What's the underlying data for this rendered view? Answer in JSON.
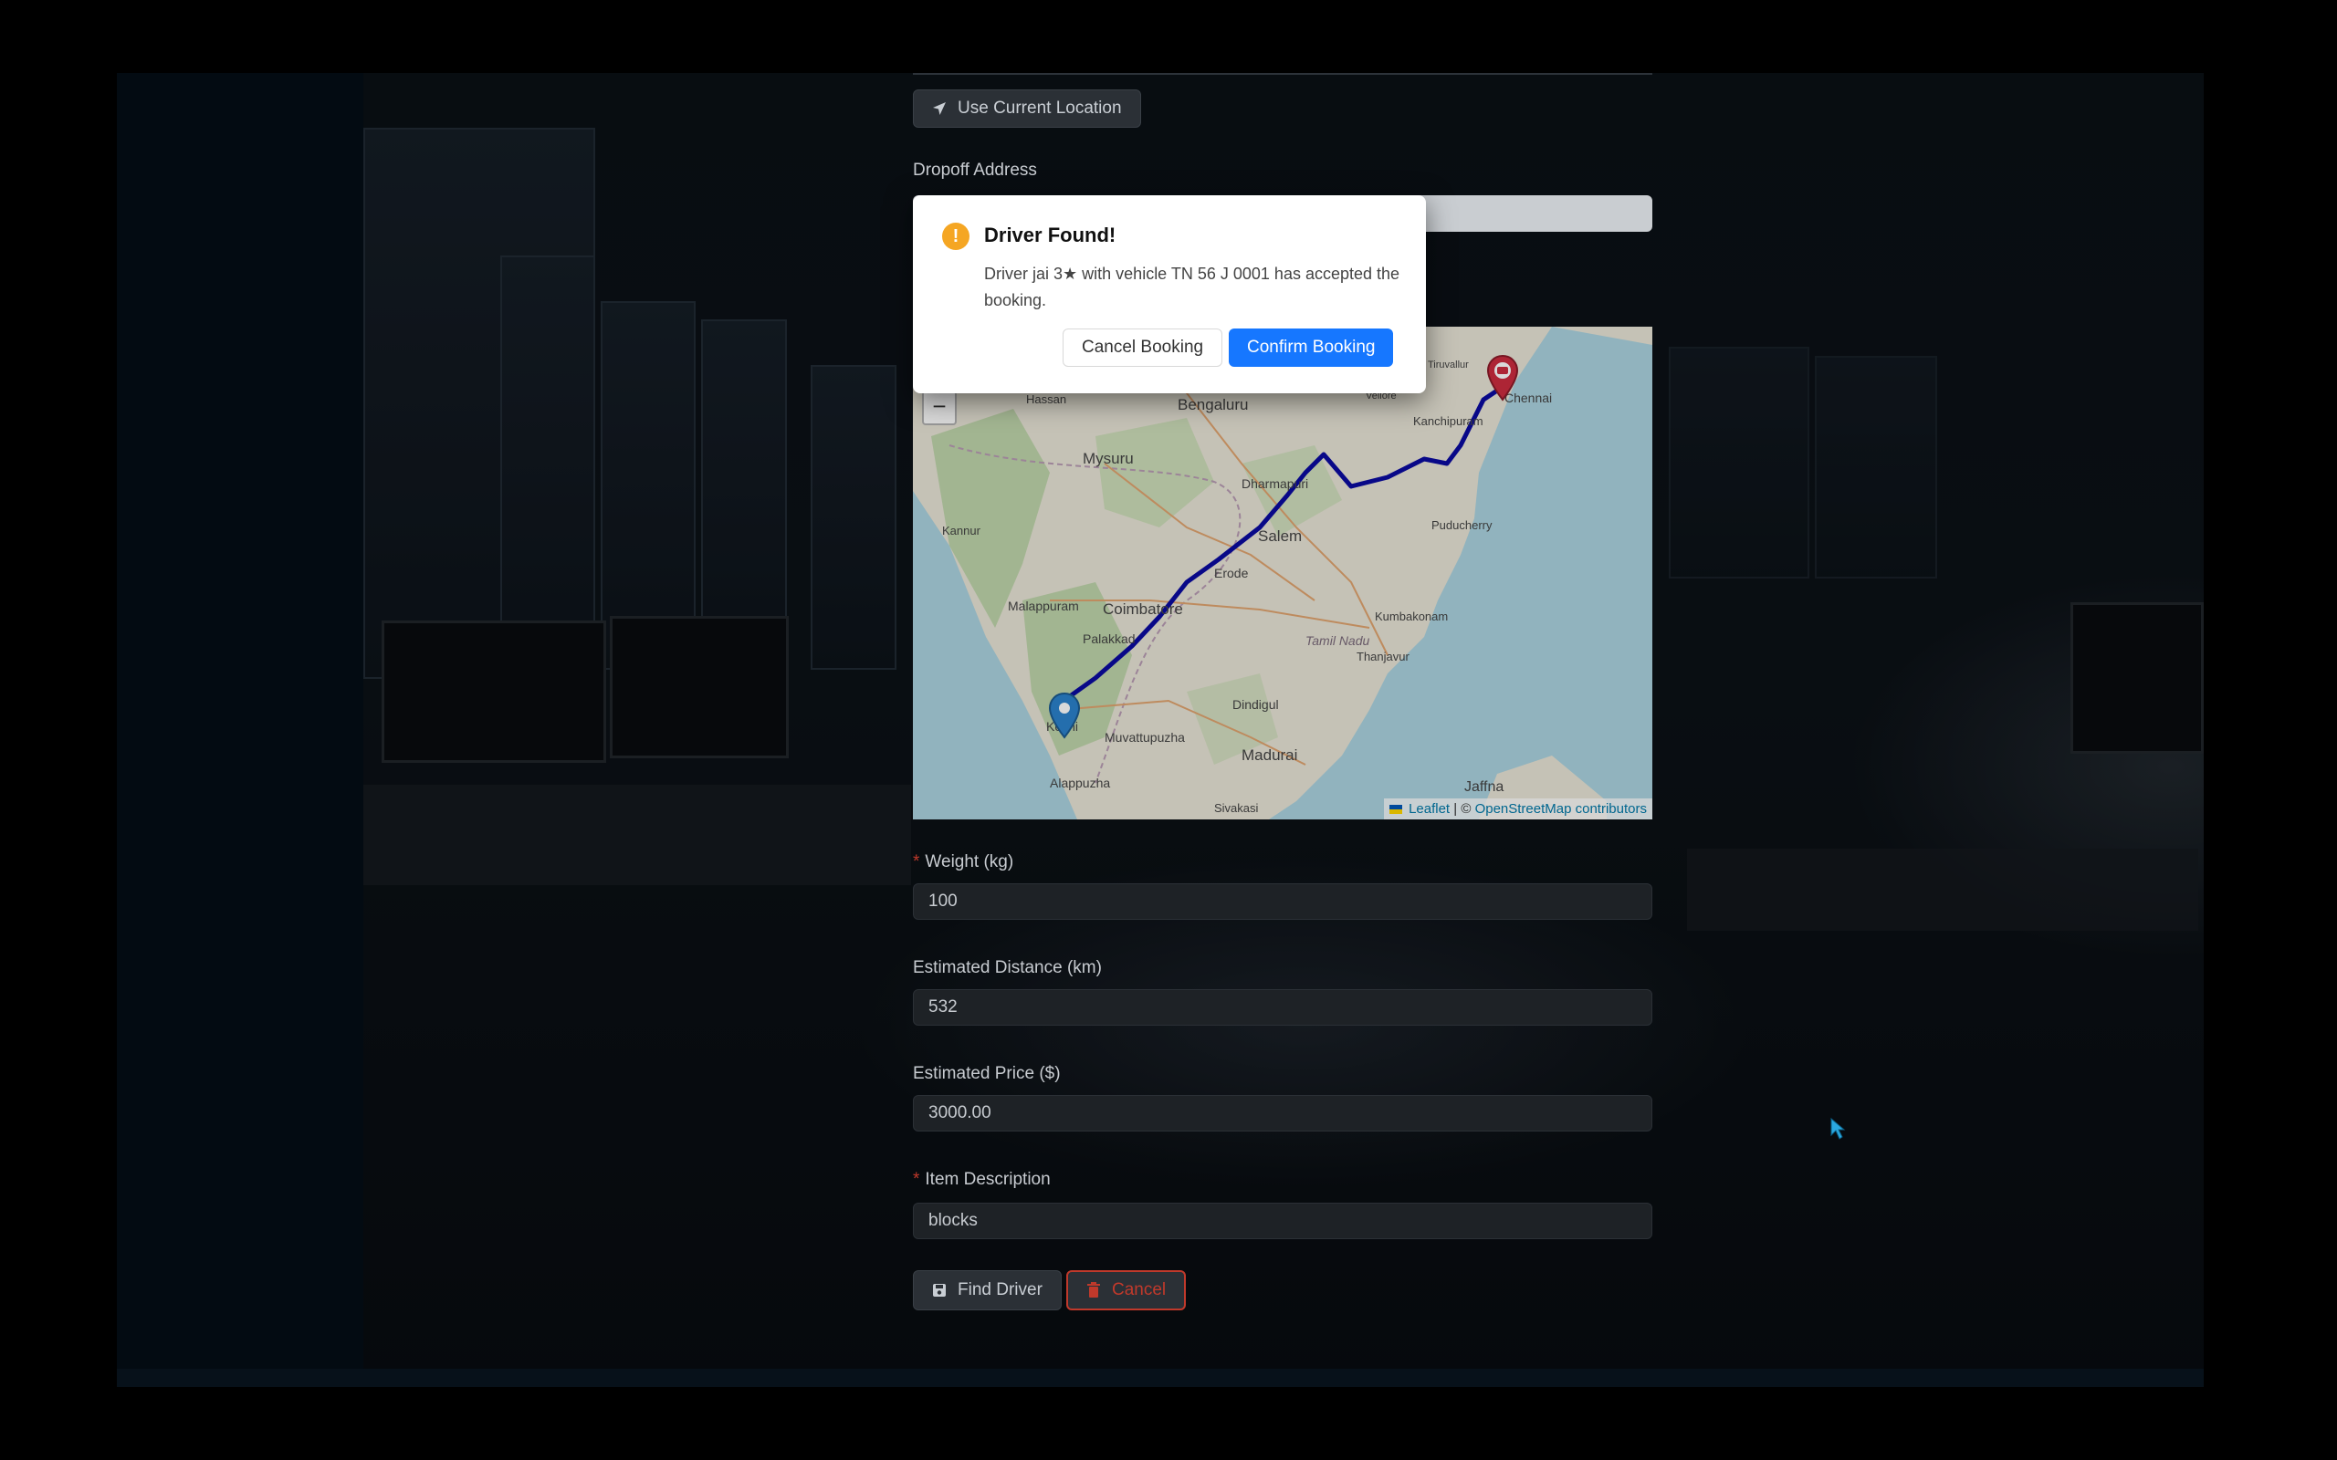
{
  "form": {
    "use_location_label": "Use Current Location",
    "dropoff_label": "Dropoff Address",
    "dropoff_value": "",
    "weight_label": "Weight (kg)",
    "weight_value": "100",
    "distance_label": "Estimated Distance (km)",
    "distance_value": "532",
    "price_label": "Estimated Price ($)",
    "price_value": "3000.00",
    "description_label": "Item Description",
    "description_value": "blocks",
    "required_mark": "*",
    "find_driver_label": "Find Driver",
    "cancel_label": "Cancel"
  },
  "map": {
    "zoom_out": "−",
    "attribution_leaflet": "Leaflet",
    "attribution_sep": " | © ",
    "attribution_osm": "OpenStreetMap contributors",
    "places": [
      {
        "name": "Hassan"
      },
      {
        "name": "Bengaluru"
      },
      {
        "name": "Mysuru"
      },
      {
        "name": "Kannur"
      },
      {
        "name": "Dharmapuri"
      },
      {
        "name": "Kanchipuram"
      },
      {
        "name": "Salem"
      },
      {
        "name": "Puducherry"
      },
      {
        "name": "Erode"
      },
      {
        "name": "Malappuram"
      },
      {
        "name": "Coimbatore"
      },
      {
        "name": "Kumbakonam"
      },
      {
        "name": "Palakkad"
      },
      {
        "name": "Tamil Nadu"
      },
      {
        "name": "Thanjavur"
      },
      {
        "name": "Dindigul"
      },
      {
        "name": "Kochi"
      },
      {
        "name": "Muvattupuzha"
      },
      {
        "name": "Madurai"
      },
      {
        "name": "Alappuzha"
      },
      {
        "name": "Sivakasi"
      },
      {
        "name": "Jaffna"
      },
      {
        "name": "Tiruvallur"
      },
      {
        "name": "Vellore"
      },
      {
        "name": "Chennai"
      }
    ]
  },
  "modal": {
    "title": "Driver Found!",
    "icon": "!",
    "message": "Driver jai 3★ with vehicle TN 56 J 0001 has accepted the booking.",
    "cancel_booking_label": "Cancel Booking",
    "confirm_booking_label": "Confirm Booking"
  },
  "colors": {
    "route": "#0a0aa0",
    "confirm": "#1677ff",
    "warning": "#f5a623",
    "danger": "#c0392b"
  }
}
